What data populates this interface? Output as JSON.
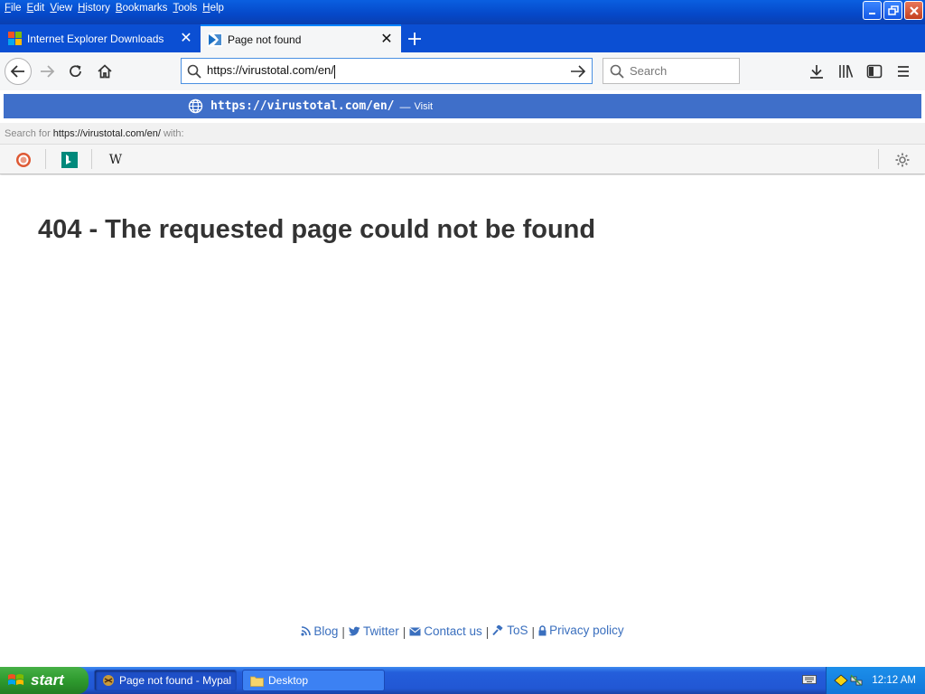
{
  "menubar": {
    "items": [
      "File",
      "Edit",
      "View",
      "History",
      "Bookmarks",
      "Tools",
      "Help"
    ]
  },
  "tabs": [
    {
      "label": "Internet Explorer Downloads",
      "icon": "windows-logo-icon",
      "active": false
    },
    {
      "label": "Page not found",
      "icon": "virustotal-logo-icon",
      "active": true
    }
  ],
  "navbar": {
    "url": "https://virustotal.com/en/",
    "search_placeholder": "Search"
  },
  "suggestion": {
    "url": "https://virustotal.com/en/",
    "separator": "—",
    "action": "Visit"
  },
  "searchfor": {
    "prefix": "Search for",
    "query": "https://virustotal.com/en/",
    "suffix": "with:"
  },
  "engines": [
    {
      "name": "duckduckgo-icon"
    },
    {
      "name": "bing-icon"
    },
    {
      "name": "wikipedia-icon",
      "glyph": "W"
    }
  ],
  "page": {
    "heading": "404 - The requested page could not be found",
    "footer_links": [
      {
        "label": "Blog",
        "icon": "rss-icon"
      },
      {
        "label": "Twitter",
        "icon": "twitter-icon"
      },
      {
        "label": "Contact us",
        "icon": "envelope-icon"
      },
      {
        "label": "ToS",
        "icon": "gavel-icon"
      },
      {
        "label": "Privacy policy",
        "icon": "lock-icon"
      }
    ],
    "footer_separator": "|"
  },
  "taskbar": {
    "start_label": "start",
    "tasks": [
      {
        "label": "Page not found - Mypal",
        "icon": "mypal-icon",
        "active": true
      },
      {
        "label": "Desktop",
        "icon": "folder-icon",
        "active": false
      }
    ],
    "clock": "12:12 AM"
  },
  "colors": {
    "accent": "#0a84ff",
    "popup_highlight": "#3f6fc9",
    "link": "#3a6fbe",
    "xp_blue": "#245edb",
    "start_green": "#2e9a2e"
  }
}
